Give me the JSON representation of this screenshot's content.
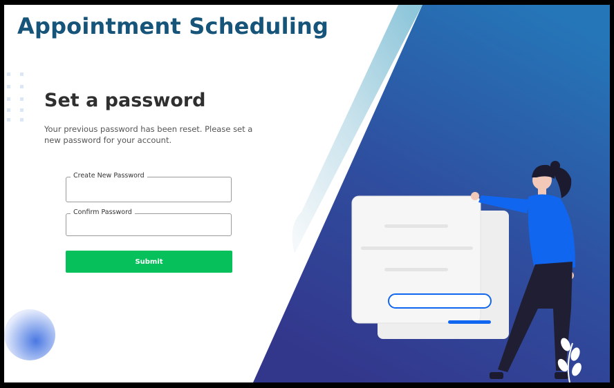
{
  "app": {
    "title": "Appointment Scheduling"
  },
  "form": {
    "heading": "Set a password",
    "description": "Your previous password has been reset. Please set a new password for your account.",
    "new_password": {
      "label": "Create New Password",
      "value": ""
    },
    "confirm_password": {
      "label": "Confirm Password",
      "value": ""
    },
    "submit_label": "Submit"
  },
  "colors": {
    "title": "#16547a",
    "panel_blue_top": "#2576b8",
    "panel_blue_bottom": "#33378c",
    "submit": "#06c15b",
    "illustration_accent": "#1166f0"
  },
  "illustration": {
    "icon": "person-with-password-card"
  }
}
